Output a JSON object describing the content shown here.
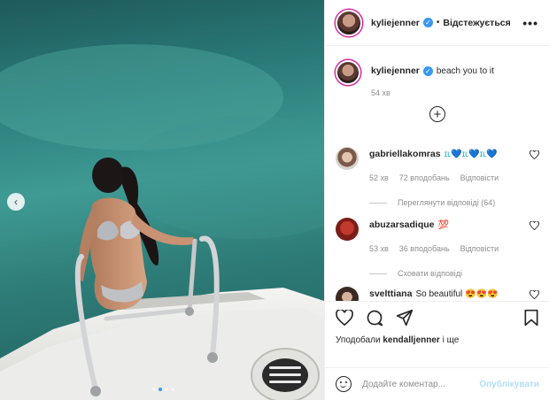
{
  "header": {
    "username": "kyliejenner",
    "separator": "•",
    "follow_label": "Відстежується",
    "more_label": "•••"
  },
  "caption": {
    "username": "kyliejenner",
    "text": "beach you to it",
    "time": "54 хв"
  },
  "load_more_label": "+",
  "comments": [
    {
      "username": "gabriellakomras",
      "text": "ɪʟ💙ɪʟ💙ɪʟ💙",
      "time": "52 хв",
      "likes": "72 вподобань",
      "reply_label": "Відповісти",
      "replies_label": "Переглянути відповіді (64)"
    },
    {
      "username": "abuzarsadique",
      "text": "💯",
      "time": "53 хв",
      "likes": "36 вподобань",
      "reply_label": "Відповісти",
      "replies_label": "Сховати відповіді"
    },
    {
      "username": "svelttiana",
      "text": "So beautiful 😍😍😍"
    }
  ],
  "actions": {
    "liked_by_prefix": "Уподобали",
    "liked_by_user": "kendalljenner",
    "liked_by_suffix": "і ще"
  },
  "add_comment": {
    "placeholder": "Додайте коментар...",
    "post_label": "Опублікувати"
  },
  "photo": {
    "prev_label": "‹",
    "carousel": {
      "count": 4,
      "active": 2
    }
  },
  "colors": {
    "verified": "#3897f0",
    "sea_teal": "#3f9b94",
    "post_disabled": "#b2dffc"
  }
}
